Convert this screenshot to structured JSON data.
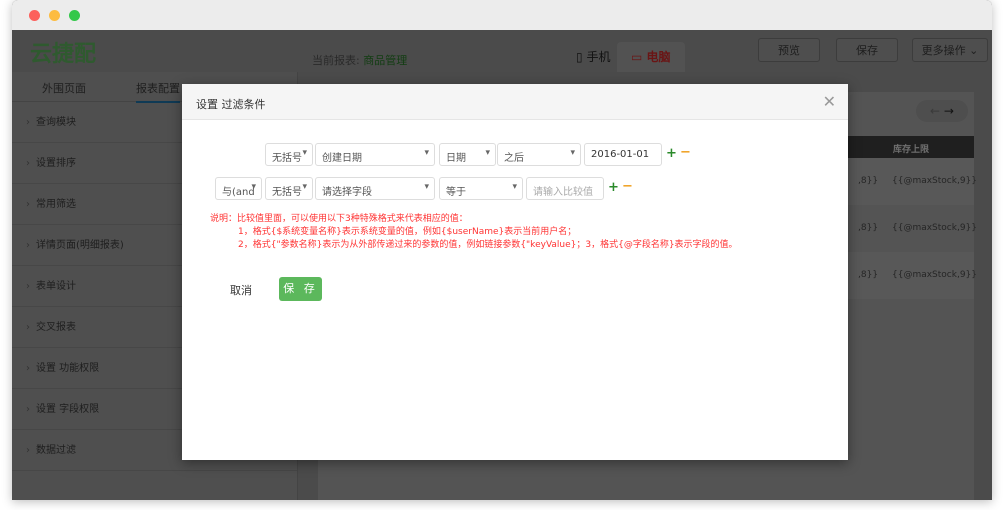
{
  "window": {
    "dot_colors": [
      "#fc605c",
      "#fdbc40",
      "#34c84a"
    ]
  },
  "header": {
    "logo": "云捷配",
    "current_report_label": "当前报表:",
    "current_report": "商品管理",
    "device_tabs": [
      "手机",
      "电脑"
    ],
    "buttons": {
      "preview": "预览",
      "save": "保存",
      "more": "更多操作 ⌄"
    }
  },
  "sidebar": {
    "tabs": [
      "外围页面",
      "报表配置"
    ],
    "items": [
      "查询模块",
      "设置排序",
      "常用筛选",
      "详情页面(明细报表)",
      "表单设计",
      "交叉报表",
      "设置 功能权限",
      "设置 字段权限",
      "数据过滤"
    ]
  },
  "main": {
    "column_header": "库存上限",
    "rows": [
      {
        "prev": ",8}}",
        "value": "{{@maxStock,9}}"
      },
      {
        "prev": ",8}}",
        "value": "{{@maxStock,9}}"
      },
      {
        "prev": ",8}}",
        "value": "{{@maxStock,9}}"
      }
    ]
  },
  "modal": {
    "title": "设置 过滤条件",
    "row1": {
      "bracket": "无括号",
      "field": "创建日期",
      "type": "日期",
      "operator": "之后",
      "value": "2016-01-01"
    },
    "row2": {
      "logic": "与(and",
      "bracket": "无括号",
      "field": "请选择字段",
      "operator": "等于",
      "value_placeholder": "请输入比较值"
    },
    "note": [
      "说明：比较值里面，可以使用以下3种特殊格式来代表相应的值：",
      "1，格式{$系统变量名称}表示系统变量的值，例如{$userName}表示当前用户名；",
      "2，格式{\"参数名称}表示为从外部传递过来的参数的值，例如链接参数{\"keyValue}；3，格式{@字段名称}表示字段的值。"
    ],
    "cancel": "取消",
    "save": "保 存"
  }
}
